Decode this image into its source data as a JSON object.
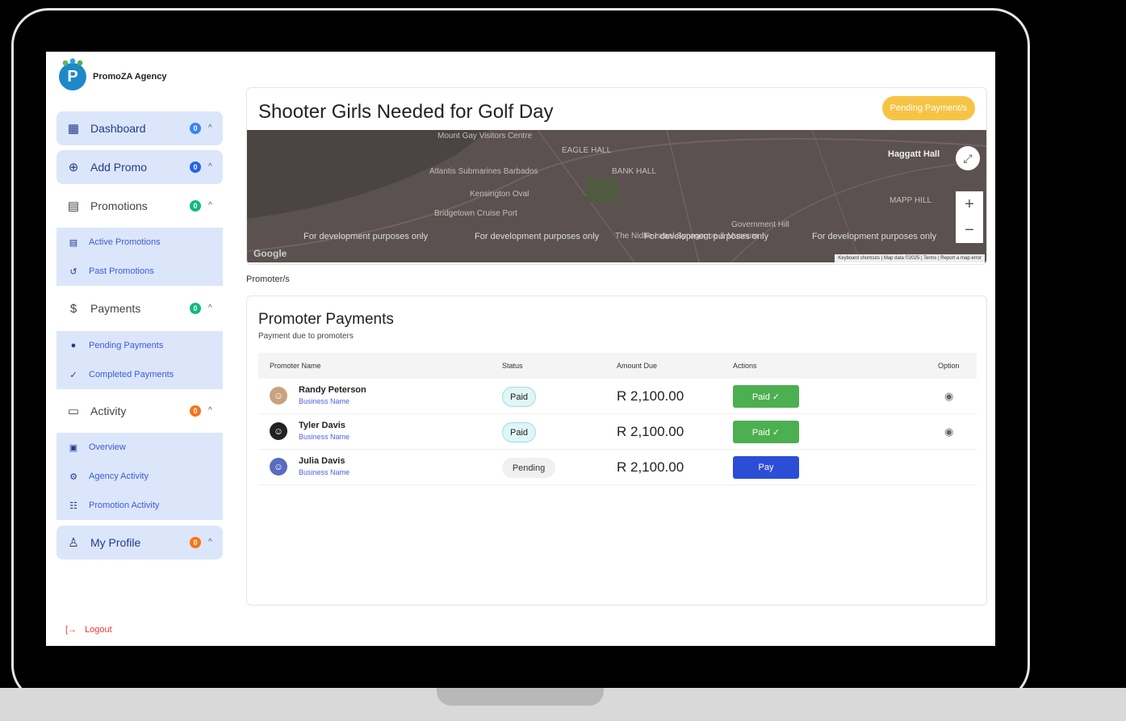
{
  "brand": {
    "name": "PromoZA Agency",
    "logo_letter": "P"
  },
  "sidebar": {
    "items": [
      {
        "label": "Dashboard",
        "badge": "0",
        "badge_color": "#3b82f6",
        "icon": "grid-icon"
      },
      {
        "label": "Add Promo",
        "badge": "0",
        "badge_color": "#2563eb",
        "icon": "plus-circle-icon"
      },
      {
        "label": "Promotions",
        "badge": "0",
        "badge_color": "#10b981",
        "icon": "document-icon"
      },
      {
        "label": "Payments",
        "badge": "0",
        "badge_color": "#10b981",
        "icon": "dollar-icon"
      },
      {
        "label": "Activity",
        "badge": "0",
        "badge_color": "#f97316",
        "icon": "chat-icon"
      },
      {
        "label": "My Profile",
        "badge": "0",
        "badge_color": "#f97316",
        "icon": "user-icon"
      }
    ],
    "promotions_sub": [
      "Active Promotions",
      "Past Promotions"
    ],
    "payments_sub": [
      "Pending Payments",
      "Completed Payments"
    ],
    "activity_sub": [
      "Overview",
      "Agency Activity",
      "Promotion Activity"
    ],
    "logout": "Logout"
  },
  "promo": {
    "title": "Shooter Girls Needed for Golf Day",
    "status_pill": "Pending Payment/s"
  },
  "map": {
    "labels": [
      "Mount Gay Visitors Centre",
      "EAGLE HALL",
      "Atlantis Submarines Barbados",
      "BANK HALL",
      "Kensington Oval",
      "Haggatt Hall",
      "MAPP HILL",
      "Bridgetown Cruise Port",
      "The Nidhe Israel Synagogue & Museum",
      "Government Hill"
    ],
    "watermark": "For development purposes only",
    "footer": "Keyboard shortcuts | Map data ©2025 | Terms | Report a map error",
    "google": "Google"
  },
  "promoter_caption": "Promoter/s",
  "payments": {
    "title": "Promoter Payments",
    "subtitle": "Payment due to promoters",
    "columns": [
      "Promoter Name",
      "Status",
      "Amount Due",
      "Actions",
      "Option"
    ],
    "rows": [
      {
        "name": "Randy Peterson",
        "business": "Business Name",
        "status": "Paid",
        "amount": "R 2,100.00",
        "action": "Paid ✓"
      },
      {
        "name": "Tyler Davis",
        "business": "Business Name",
        "status": "Paid",
        "amount": "R 2,100.00",
        "action": "Paid ✓"
      },
      {
        "name": "Julia Davis",
        "business": "Business Name",
        "status": "Pending",
        "amount": "R 2,100.00",
        "action": "Pay"
      }
    ]
  }
}
